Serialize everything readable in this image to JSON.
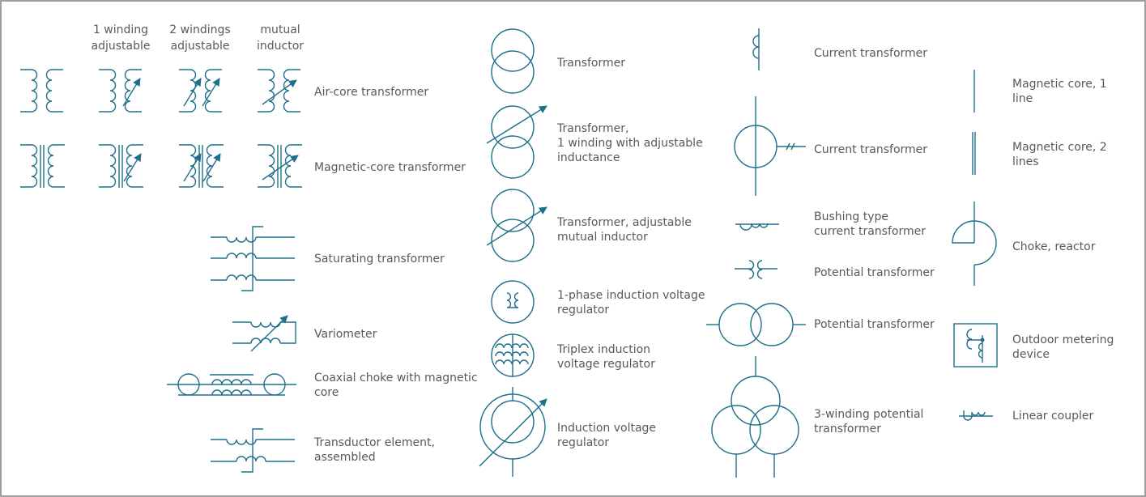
{
  "colors": {
    "stroke": "#1f6e8c",
    "text": "#58595b",
    "frame": "#9e9e9e",
    "background": "#ffffff"
  },
  "column_headers": [
    {
      "id": "hdr-1-winding",
      "text": "1 winding\nadjustable"
    },
    {
      "id": "hdr-2-windings",
      "text": "2 windings\nadjustable"
    },
    {
      "id": "hdr-mutual",
      "text": "mutual\ninductor"
    }
  ],
  "symbols": [
    {
      "id": "air-core-transformer",
      "label": "Air-core transformer"
    },
    {
      "id": "magnetic-core-transformer",
      "label": "Magnetic-core transformer"
    },
    {
      "id": "saturating-transformer",
      "label": "Saturating transformer"
    },
    {
      "id": "variometer",
      "label": "Variometer"
    },
    {
      "id": "coaxial-choke",
      "label": "Coaxial choke with magnetic\ncore"
    },
    {
      "id": "transductor-element",
      "label": "Transductor element,\nassembled"
    },
    {
      "id": "transformer",
      "label": "Transformer"
    },
    {
      "id": "transformer-1-winding-adjustable",
      "label": "Transformer,\n1 winding with adjustable\ninductance"
    },
    {
      "id": "transformer-adjustable-mutual",
      "label": "Transformer, adjustable\nmutual inductor"
    },
    {
      "id": "1-phase-induction-voltage-regulator",
      "label": "1-phase induction voltage\nregulator"
    },
    {
      "id": "triplex-induction-voltage-regulator",
      "label": "Triplex induction\nvoltage regulator"
    },
    {
      "id": "induction-voltage-regulator",
      "label": "Induction voltage\nregulator"
    },
    {
      "id": "current-transformer-1",
      "label": "Current transformer"
    },
    {
      "id": "current-transformer-2",
      "label": "Current transformer"
    },
    {
      "id": "bushing-type-current-transformer",
      "label": "Bushing type\ncurrent transformer"
    },
    {
      "id": "potential-transformer-1",
      "label": "Potential transformer"
    },
    {
      "id": "potential-transformer-2",
      "label": "Potential transformer"
    },
    {
      "id": "3-winding-potential-transformer",
      "label": "3-winding potential\ntransformer"
    },
    {
      "id": "magnetic-core-1-line",
      "label": "Magnetic core, 1\nline"
    },
    {
      "id": "magnetic-core-2-lines",
      "label": "Magnetic core, 2\nlines"
    },
    {
      "id": "choke-reactor",
      "label": "Choke, reactor"
    },
    {
      "id": "outdoor-metering-device",
      "label": "Outdoor metering\ndevice"
    },
    {
      "id": "linear-coupler",
      "label": "Linear coupler"
    }
  ]
}
